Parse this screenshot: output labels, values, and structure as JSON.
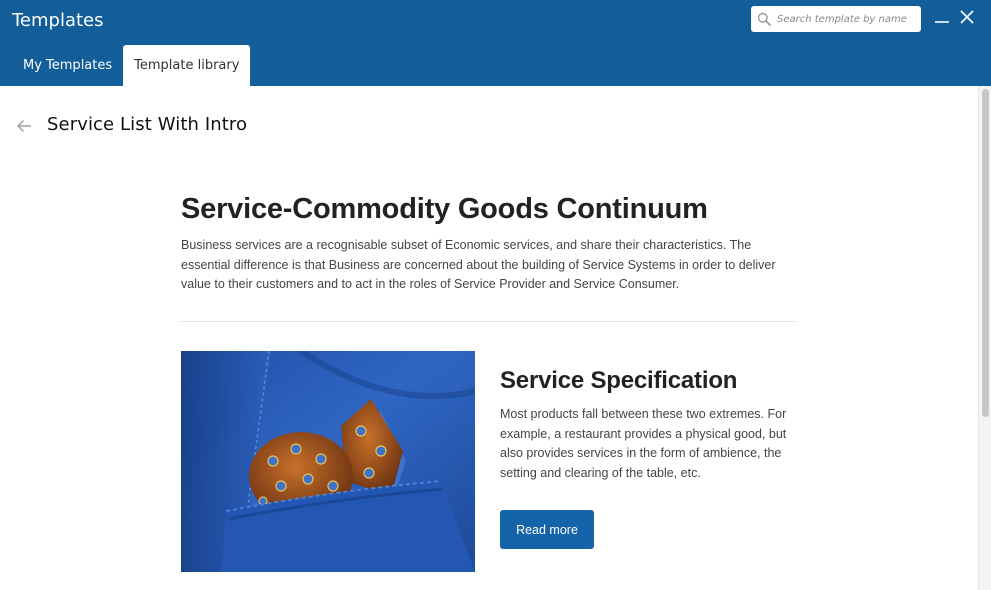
{
  "app": {
    "title": "Templates"
  },
  "search": {
    "placeholder": "Search template by name",
    "value": ""
  },
  "window_controls": {
    "minimize_icon": "minimize-icon",
    "close_icon": "close-icon"
  },
  "tabs": [
    {
      "label": "My Templates",
      "active": false
    },
    {
      "label": "Template library",
      "active": true
    }
  ],
  "page": {
    "title": "Service List With Intro",
    "back_icon": "arrow-left-icon"
  },
  "preview": {
    "hero_title": "Service-Commodity Goods Continuum",
    "hero_text": "Business services are a recognisable subset of Economic services, and share their characteristics. The essential difference is that Business are concerned about the building of Service Systems in order to deliver value to their customers and to act in the roles of Service Provider and Service Consumer.",
    "feature_title": "Service Specification",
    "feature_text": "Most products fall between these two extremes. For example, a restaurant provides a physical good, but also provides services in the form of ambience, the setting and clearing of the table, etc.",
    "read_more_label": "Read more"
  },
  "colors": {
    "header_bg": "#135d98",
    "button_bg": "#1563a8",
    "jacket_blue": "#2a5fb8",
    "pocket_square": "#a8541a"
  }
}
